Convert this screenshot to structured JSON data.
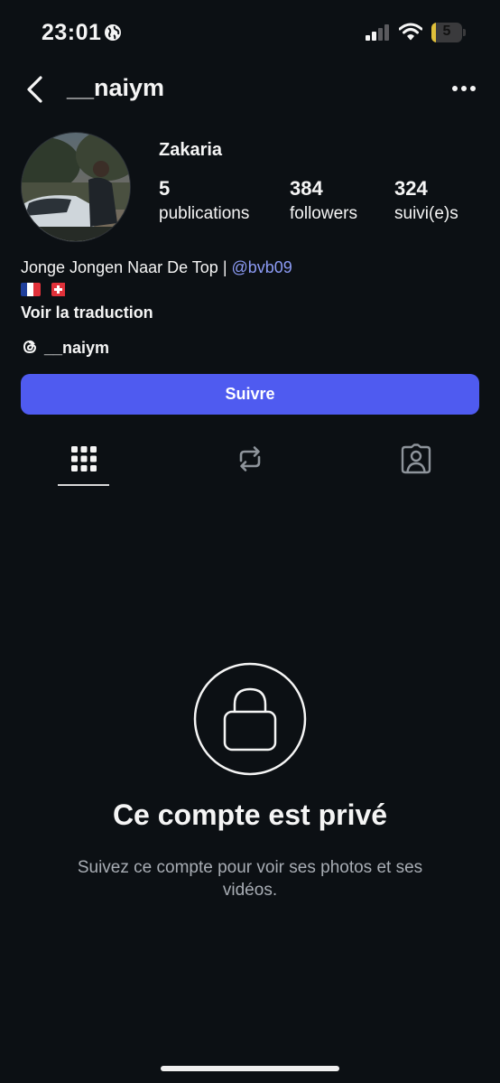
{
  "status_bar": {
    "time": "23:01",
    "battery_level": "5",
    "battery_fill_fraction": 0.15,
    "battery_color": "#e0c03a",
    "icons": [
      "globe-icon",
      "cellular-signal-icon",
      "wifi-icon",
      "battery-icon"
    ]
  },
  "header": {
    "username": "__naiym",
    "back_icon": "chevron-left-icon",
    "more_icon": "more-horizontal-icon"
  },
  "profile": {
    "display_name": "Zakaria",
    "stats": {
      "posts": {
        "value": "5",
        "label": "publications"
      },
      "followers": {
        "value": "384",
        "label": "followers"
      },
      "following": {
        "value": "324",
        "label": "suivi(e)s"
      }
    },
    "bio": {
      "text": "Jonge Jongen Naar De Top | ",
      "mention": "@bvb09",
      "flags": [
        "france-flag",
        "switzerland-flag"
      ]
    },
    "translate_label": "Voir la traduction",
    "threads_handle": "__naiym"
  },
  "actions": {
    "follow_label": "Suivre",
    "accent_color": "#4f5bf0"
  },
  "tabs": [
    {
      "name": "grid",
      "icon": "grid-icon",
      "active": true
    },
    {
      "name": "reposts",
      "icon": "repost-icon",
      "active": false
    },
    {
      "name": "tagged",
      "icon": "tagged-person-icon",
      "active": false
    }
  ],
  "private_notice": {
    "title": "Ce compte est privé",
    "subtitle": "Suivez ce compte pour voir ses photos et ses vidéos.",
    "icon": "lock-icon"
  }
}
